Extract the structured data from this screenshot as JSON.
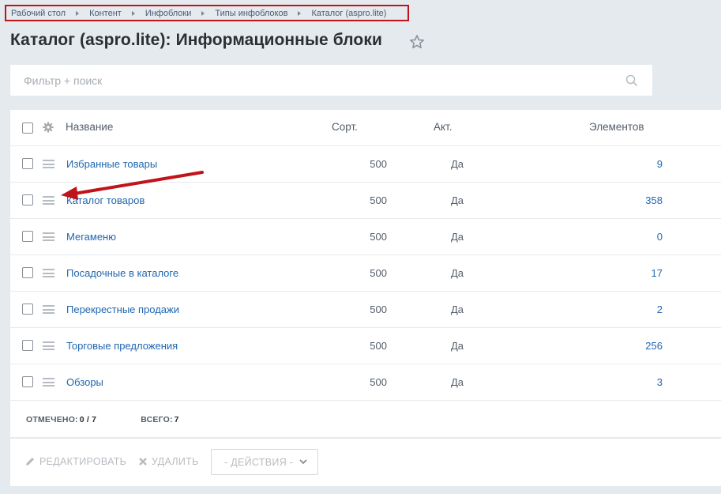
{
  "breadcrumb": [
    "Рабочий стол",
    "Контент",
    "Инфоблоки",
    "Типы инфоблоков",
    "Каталог (aspro.lite)"
  ],
  "page_title": "Каталог (aspro.lite): Информационные блоки",
  "filter": {
    "placeholder": "Фильтр + поиск"
  },
  "table": {
    "headers": {
      "name": "Название",
      "sort": "Сорт.",
      "active": "Акт.",
      "elements": "Элементов"
    },
    "rows": [
      {
        "name": "Избранные товары",
        "sort": "500",
        "active": "Да",
        "elements": "9"
      },
      {
        "name": "Каталог товаров",
        "sort": "500",
        "active": "Да",
        "elements": "358"
      },
      {
        "name": "Мегаменю",
        "sort": "500",
        "active": "Да",
        "elements": "0"
      },
      {
        "name": "Посадочные в каталоге",
        "sort": "500",
        "active": "Да",
        "elements": "17"
      },
      {
        "name": "Перекрестные продажи",
        "sort": "500",
        "active": "Да",
        "elements": "2"
      },
      {
        "name": "Торговые предложения",
        "sort": "500",
        "active": "Да",
        "elements": "256"
      },
      {
        "name": "Обзоры",
        "sort": "500",
        "active": "Да",
        "elements": "3"
      }
    ]
  },
  "footer": {
    "selected_label": "ОТМЕЧЕНО:",
    "selected_value": "0 / 7",
    "total_label": "ВСЕГО:",
    "total_value": "7"
  },
  "actions": {
    "edit": "РЕДАКТИРОВАТЬ",
    "delete": "УДАЛИТЬ",
    "more": "- ДЕЙСТВИЯ -"
  },
  "colors": {
    "link": "#2067b0",
    "annotation": "#c0141b",
    "background": "#e4eaed"
  }
}
